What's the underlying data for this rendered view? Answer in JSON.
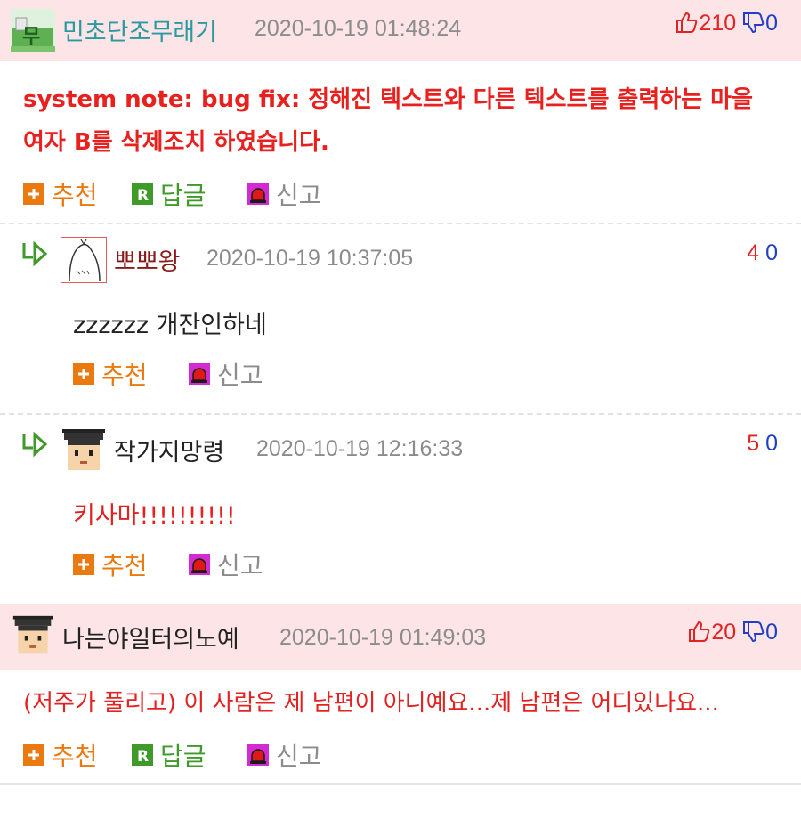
{
  "comments": [
    {
      "author": "민초단조무래기",
      "date": "2020-10-19 01:48:24",
      "upvotes": "210",
      "downvotes": "0",
      "text": "system note: bug fix: 정해진 텍스트와 다른 텍스트를 출력하는 마을 여자 B를 삭제조치 하였습니다.",
      "actions": {
        "recommend": "추천",
        "reply": "답글",
        "report": "신고"
      }
    },
    {
      "author": "나는야일터의노예",
      "date": "2020-10-19 01:49:03",
      "upvotes": "20",
      "downvotes": "0",
      "text": "(저주가 풀리고) 이 사람은 제 남편이 아니예요...제 남편은 어디있나요...",
      "actions": {
        "recommend": "추천",
        "reply": "답글",
        "report": "신고"
      }
    }
  ],
  "replies": [
    {
      "author": "뽀뽀왕",
      "date": "2020-10-19 10:37:05",
      "upvotes": "4",
      "downvotes": "0",
      "text": "zzzzzz 개잔인하네",
      "actions": {
        "recommend": "추천",
        "report": "신고"
      }
    },
    {
      "author": "작가지망령",
      "date": "2020-10-19 12:16:33",
      "upvotes": "5",
      "downvotes": "0",
      "text": "키사마!!!!!!!!!!",
      "actions": {
        "recommend": "추천",
        "report": "신고"
      }
    }
  ],
  "colors": {
    "highlight_bg": "#fde4e6",
    "red_text": "#e32222",
    "blue_text": "#1f3fc8",
    "author_teal": "#2a9aa0",
    "author_dark_red": "#8a1a1a",
    "recommend_orange": "#ea7a10",
    "reply_green": "#3f9a2a"
  },
  "icons": [
    "thumbs-up-icon",
    "thumbs-down-icon",
    "plus-icon",
    "reply-r-icon",
    "siren-icon",
    "reply-arrow-icon"
  ]
}
